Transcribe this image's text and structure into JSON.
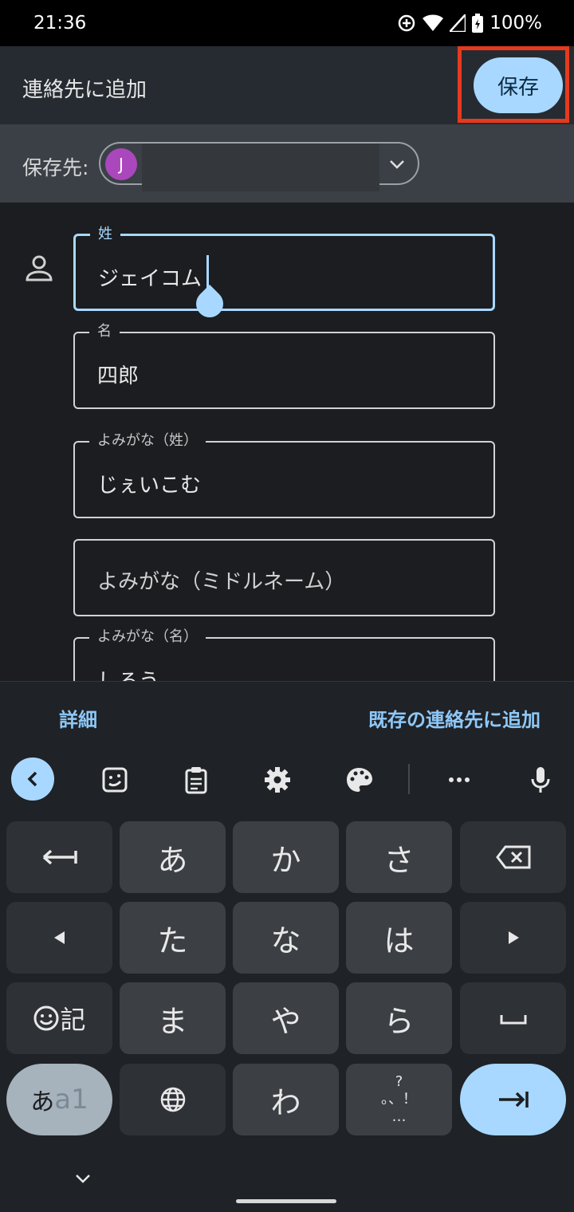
{
  "status_bar": {
    "time": "21:36",
    "battery": "100%"
  },
  "app_bar": {
    "title": "連絡先に追加",
    "save_label": "保存"
  },
  "save_to": {
    "label": "保存先:",
    "avatar_letter": "J"
  },
  "form": {
    "fields": [
      {
        "label": "姓",
        "value": "ジェイコム"
      },
      {
        "label": "名",
        "value": "四郎"
      },
      {
        "label": "よみがな（姓）",
        "value": "じぇいこむ"
      },
      {
        "label": "",
        "placeholder": "よみがな（ミドルネーム）"
      },
      {
        "label": "よみがな（名）",
        "value": "しろう"
      }
    ]
  },
  "actions": {
    "details": "詳細",
    "add_existing": "既存の連絡先に追加"
  },
  "keyboard": {
    "rows": [
      [
        "あ",
        "か",
        "さ"
      ],
      [
        "た",
        "な",
        "は"
      ],
      [
        "ま",
        "や",
        "ら"
      ],
      [
        "わ"
      ]
    ],
    "emoji_symbols_label": "記",
    "mode_label_kana": "あ",
    "mode_label_alpha": "a1",
    "punct_top": "?",
    "punct_mid": "。、！",
    "punct_bottom": "…"
  },
  "colors": {
    "accent": "#a8d8ff",
    "highlight_box": "#e53a1e",
    "avatar": "#ab47bc"
  }
}
